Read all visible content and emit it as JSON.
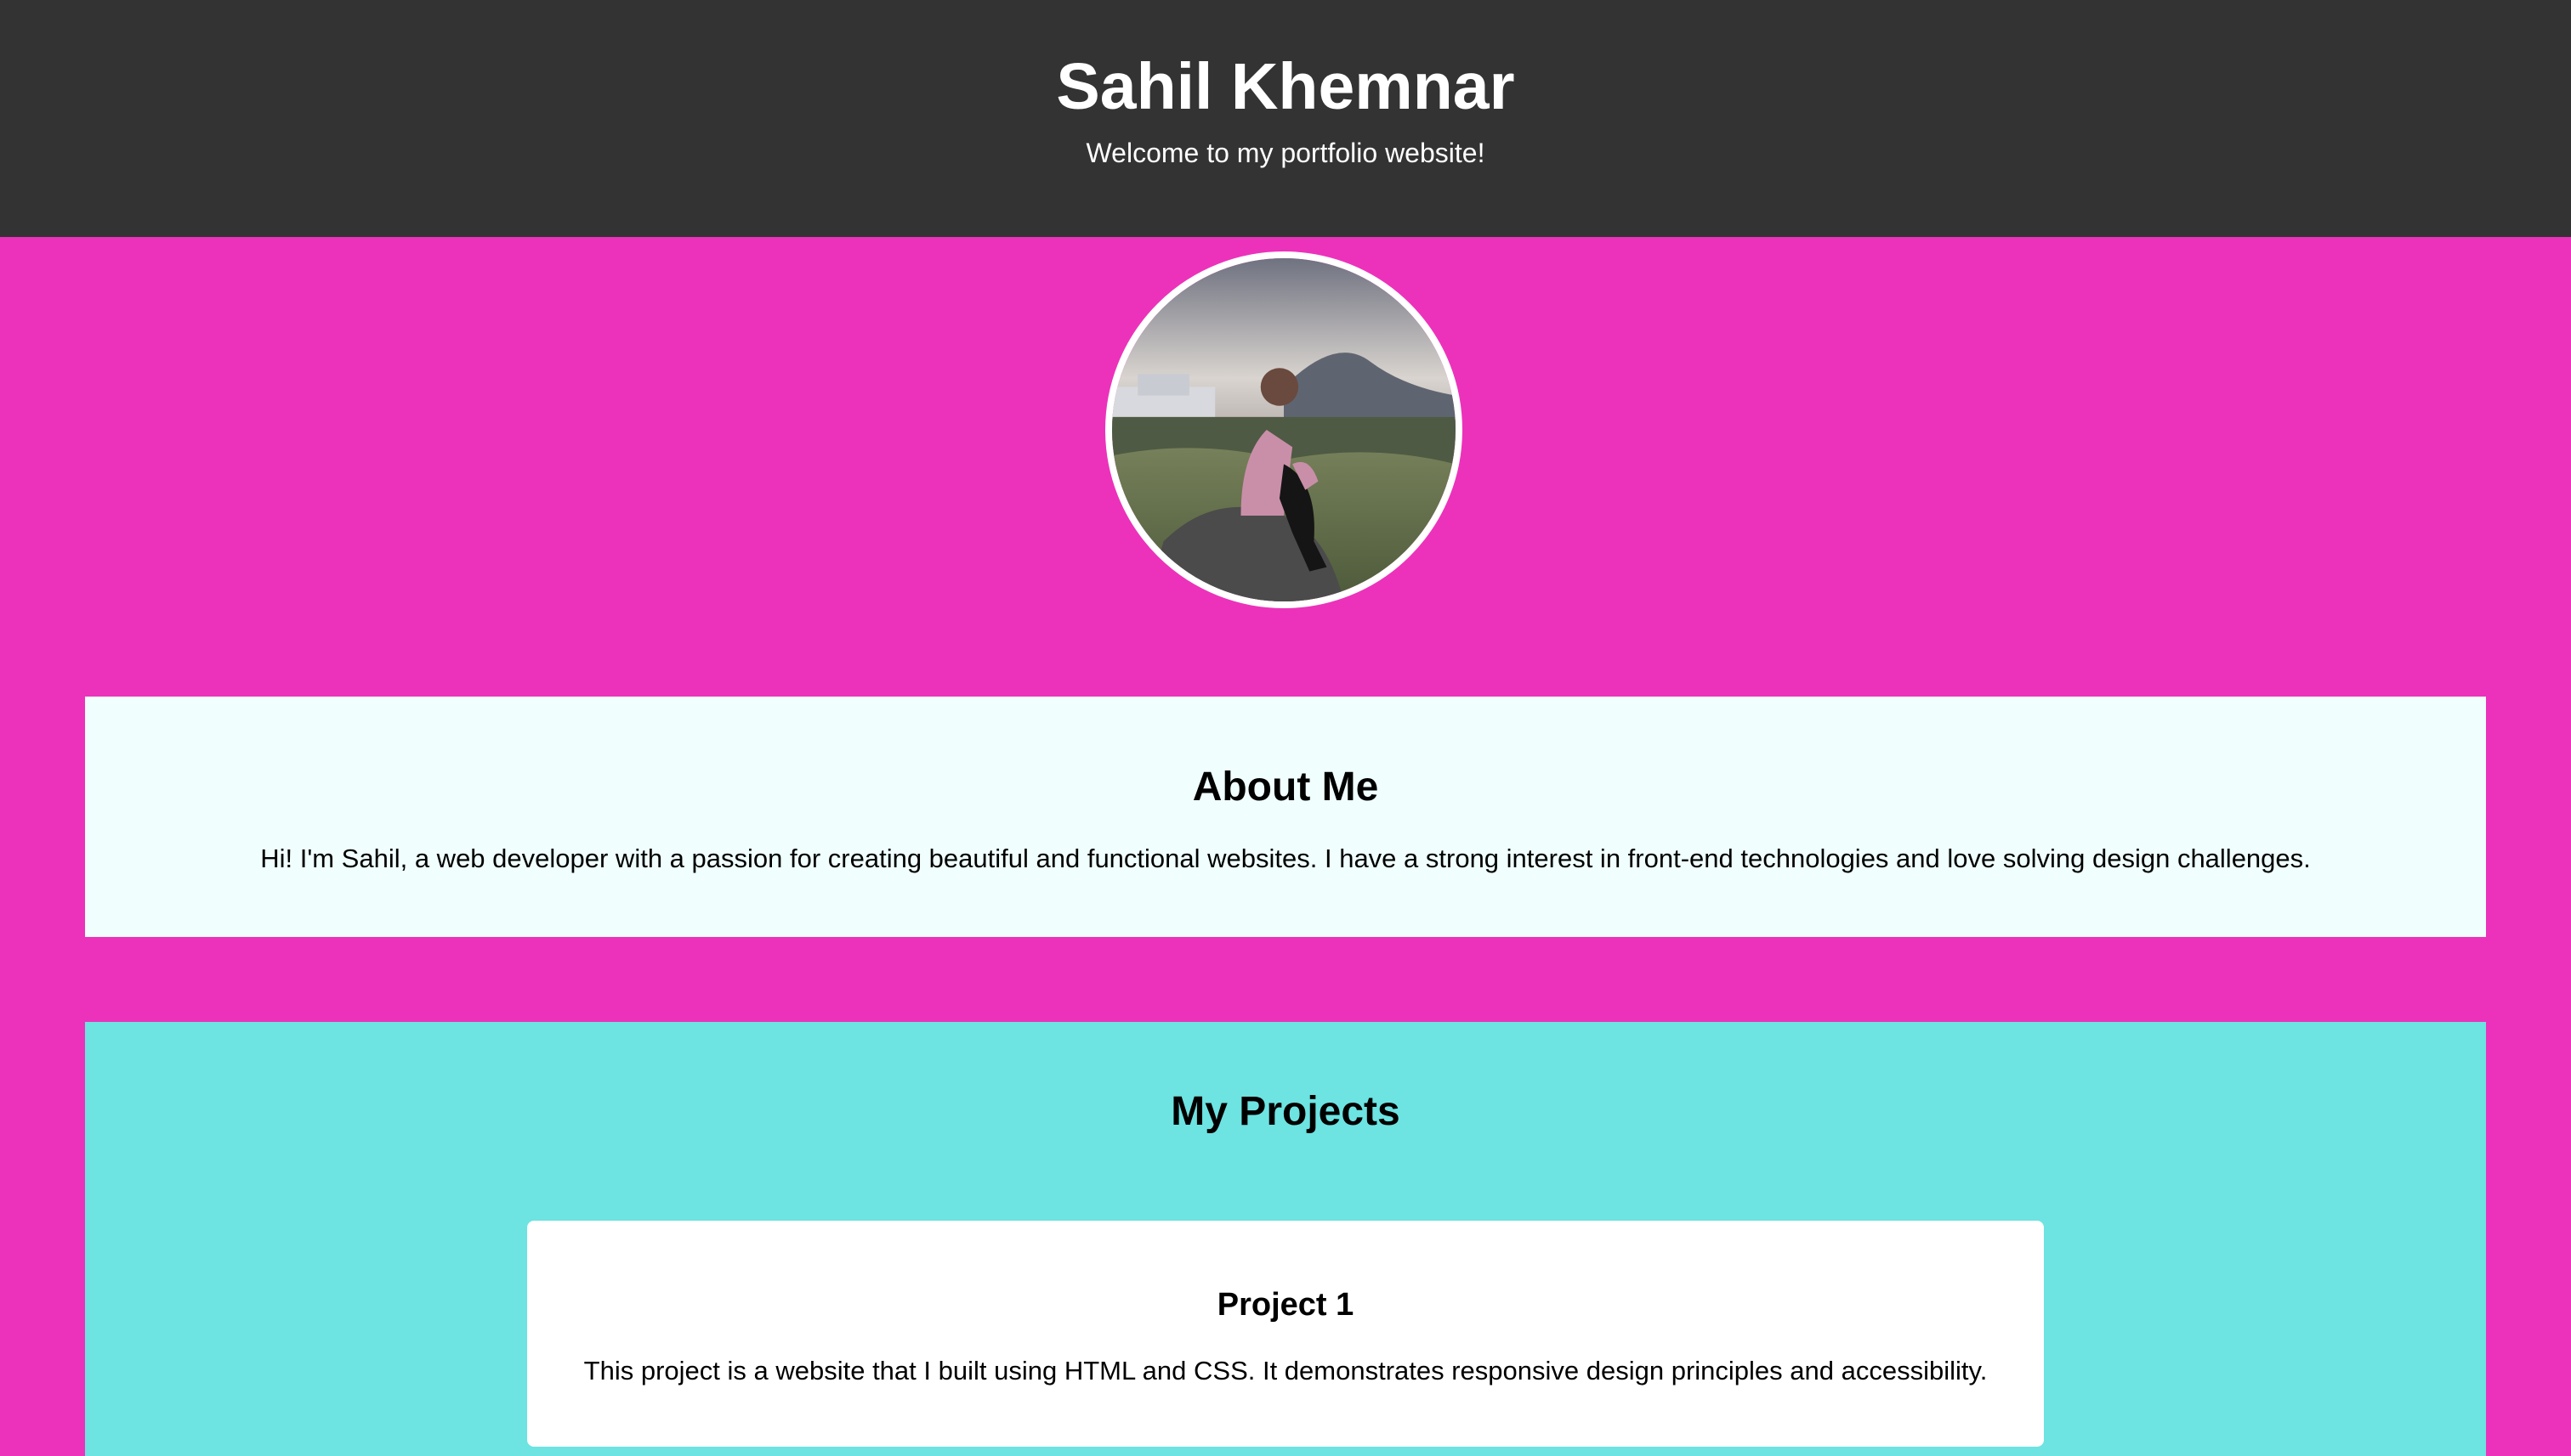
{
  "header": {
    "title": "Sahil Khemnar",
    "subtitle": "Welcome to my portfolio website!"
  },
  "about": {
    "heading": "About Me",
    "text": "Hi! I'm Sahil, a web developer with a passion for creating beautiful and functional websites. I have a strong interest in front-end technologies and love solving design challenges."
  },
  "projects": {
    "heading": "My Projects",
    "items": [
      {
        "title": "Project 1",
        "description": "This project is a website that I built using HTML and CSS. It demonstrates responsive design principles and accessibility."
      }
    ]
  },
  "colors": {
    "page_background": "#ec32bb",
    "header_background": "#333333",
    "about_background": "#f0fffe",
    "projects_background": "#6de3e2",
    "card_background": "#ffffff"
  }
}
